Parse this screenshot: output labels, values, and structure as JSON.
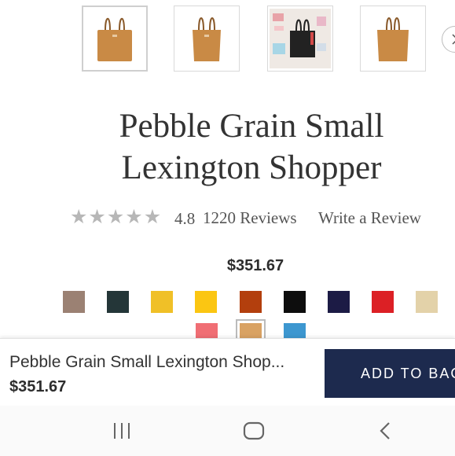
{
  "thumbnails": [
    {
      "alt": "tan tote front",
      "bag_color": "#c98a45"
    },
    {
      "alt": "tan tote angled",
      "bag_color": "#c98a45"
    },
    {
      "alt": "black tote with contents",
      "bag_color": "#222222"
    },
    {
      "alt": "tan tote side",
      "bag_color": "#c98a45"
    }
  ],
  "product": {
    "title_line1": "Pebble Grain Small",
    "title_line2": "Lexington Shopper",
    "rating": "4.8",
    "reviews_label": "1220 Reviews",
    "write_review_label": "Write a Review",
    "price": "$351.67"
  },
  "swatches": [
    {
      "name": "taupe",
      "color": "#9b8173"
    },
    {
      "name": "dark green",
      "color": "#243638"
    },
    {
      "name": "mustard",
      "color": "#f0c027"
    },
    {
      "name": "yellow",
      "color": "#fbc612"
    },
    {
      "name": "rust",
      "color": "#b33f0d"
    },
    {
      "name": "black",
      "color": "#0d0d0d"
    },
    {
      "name": "navy",
      "color": "#1c1b45"
    },
    {
      "name": "red",
      "color": "#dc2025"
    },
    {
      "name": "bone",
      "color": "#e3d2a9"
    },
    {
      "name": "coral",
      "color": "#f06e74"
    },
    {
      "name": "natural",
      "color": "#d9a263",
      "selected": true
    },
    {
      "name": "blue",
      "color": "#3d97d0"
    }
  ],
  "sticky_bar": {
    "name": "Pebble Grain Small Lexington Shop...",
    "price": "$351.67",
    "add_to_bag_label": "ADD TO BAG"
  },
  "colors": {
    "brand_navy": "#1d2a4e",
    "star_gray": "#b7b7b7"
  },
  "icons": {
    "next": "chevron-right-icon",
    "recent_apps": "recent-apps-icon",
    "home": "home-icon",
    "back": "back-icon"
  }
}
